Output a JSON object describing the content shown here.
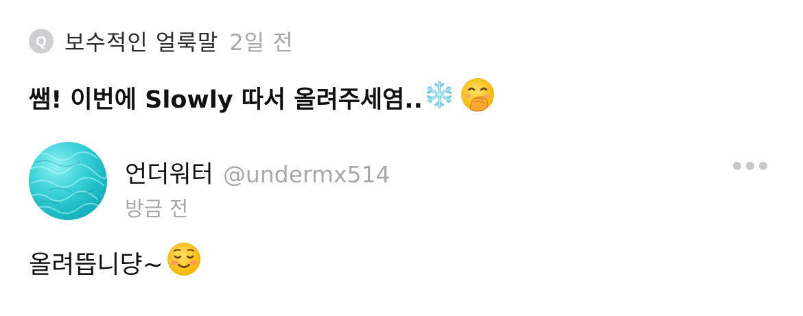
{
  "question": {
    "badge_letter": "Q",
    "asker_name": "보수적인 얼룩말",
    "asked_time": "2일 전",
    "text": "쌤! 이번에 Slowly 따서 올려주세염..",
    "emojis": [
      "snowflake-icon",
      "face-with-hand-over-mouth-icon"
    ]
  },
  "answer": {
    "author_name": "언더워터",
    "author_handle": "@undermx514",
    "time": "방금 전",
    "text": "올려뜹니댱~",
    "emojis": [
      "smiling-face-icon"
    ]
  },
  "colors": {
    "text_primary": "#111111",
    "text_secondary": "#a8a8ac",
    "badge_bg": "#cfcfd3",
    "avatar_water": "#1ab9c4"
  },
  "icons": {
    "more": "more-dots-icon",
    "question_badge": "question-badge-icon",
    "avatar": "avatar"
  }
}
